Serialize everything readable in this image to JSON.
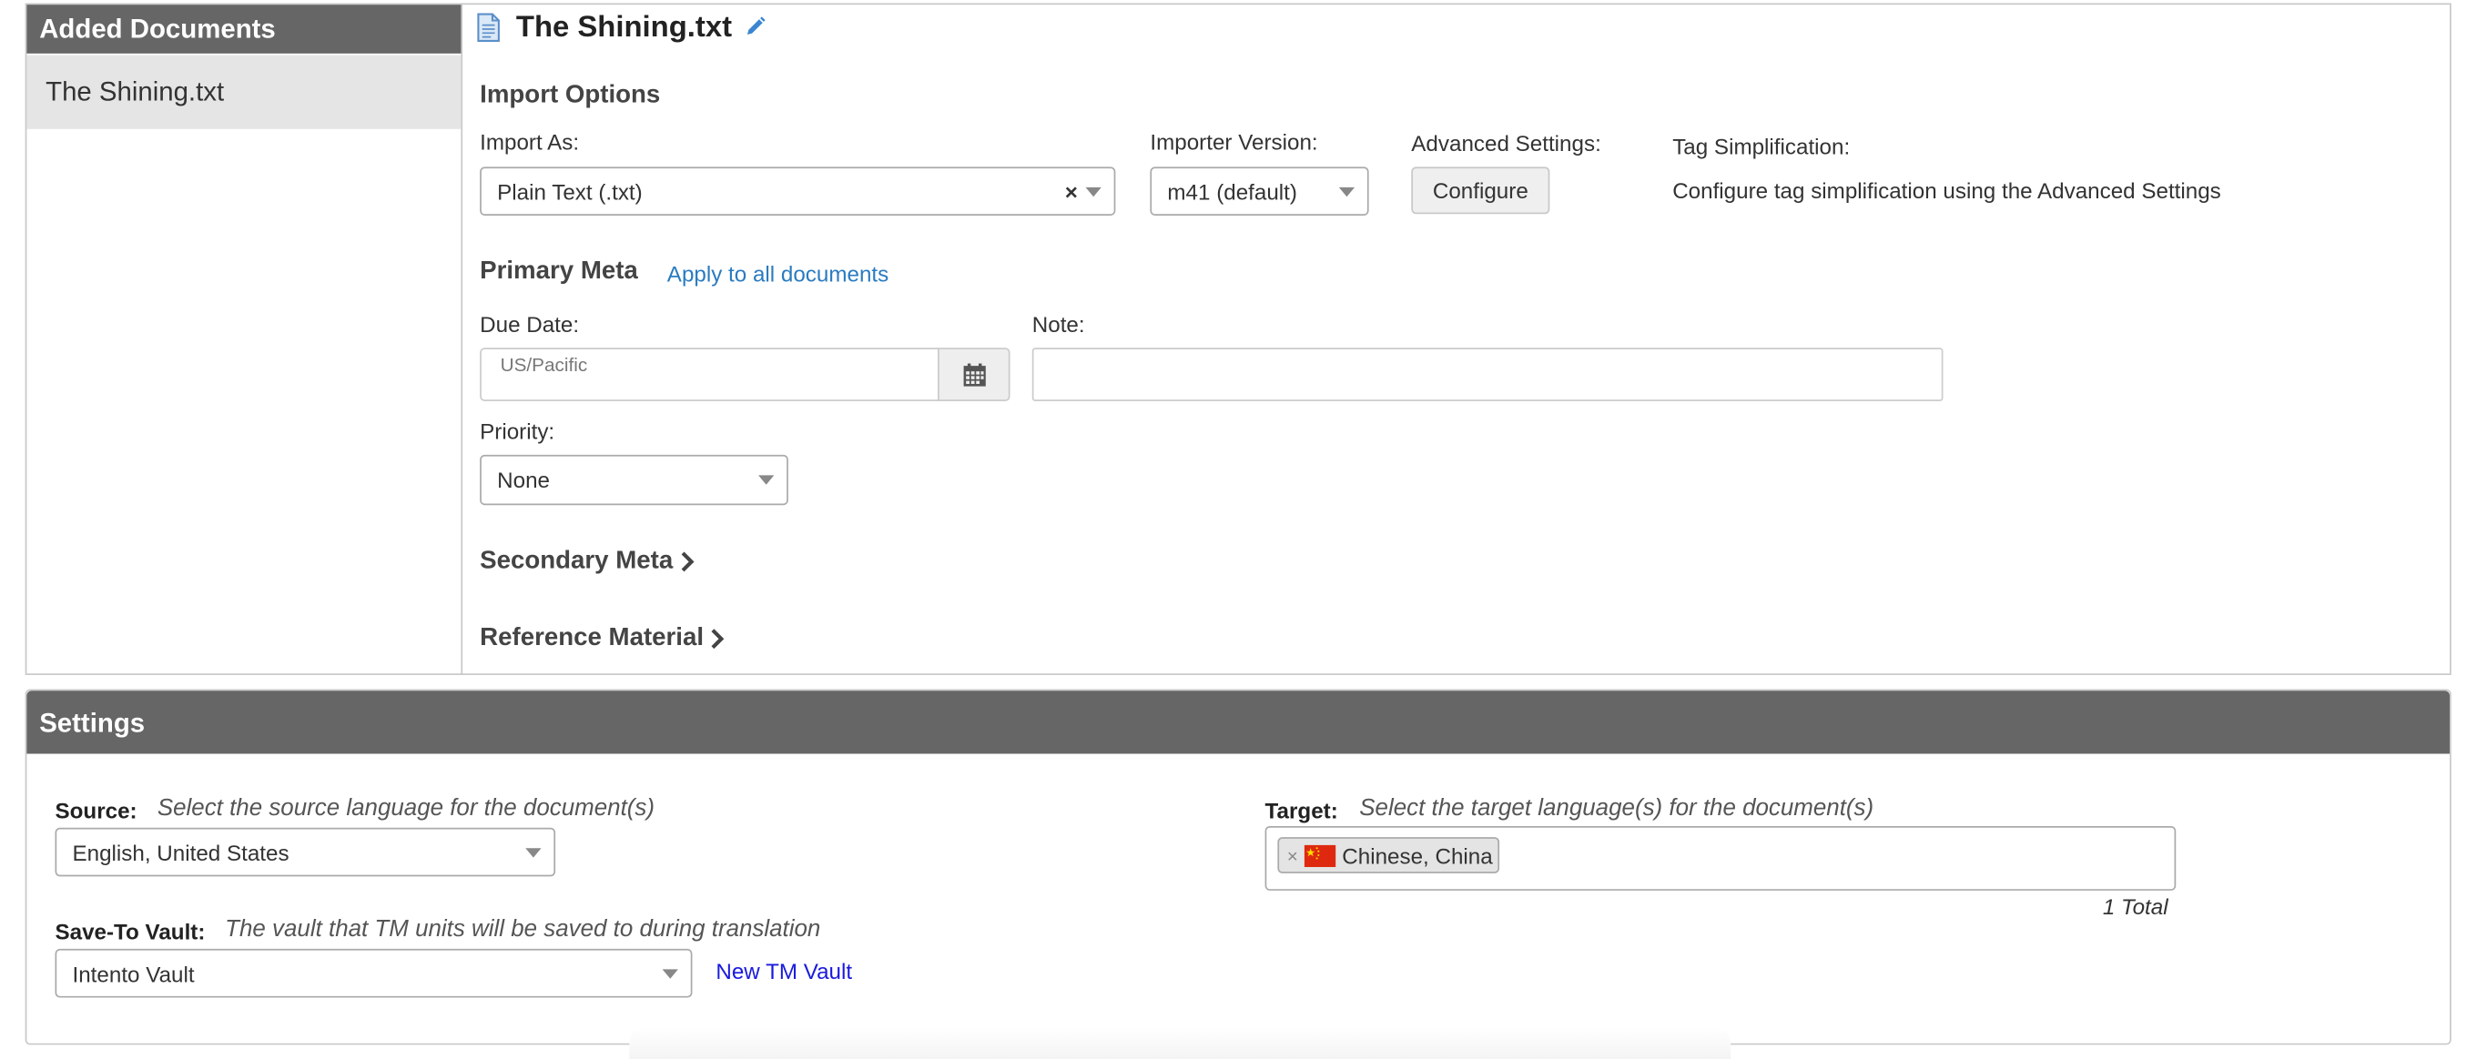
{
  "documents_panel": {
    "header": "Added Documents",
    "items": [
      {
        "label": "The Shining.txt"
      }
    ]
  },
  "document": {
    "title": "The Shining.txt",
    "icon": "file-text-icon",
    "edit_icon": "pencil-icon"
  },
  "import_options": {
    "heading": "Import Options",
    "import_as": {
      "label": "Import As:",
      "value": "Plain Text (.txt)"
    },
    "importer_version": {
      "label": "Importer Version:",
      "value": "m41 (default)"
    },
    "advanced_settings": {
      "label": "Advanced Settings:",
      "button": "Configure"
    },
    "tag_simplification": {
      "label": "Tag Simplification:",
      "text": "Configure tag simplification using the Advanced Settings"
    }
  },
  "primary_meta": {
    "heading": "Primary Meta",
    "apply_link": "Apply to all documents",
    "due_date": {
      "label": "Due Date:",
      "timezone_hint": "US/Pacific",
      "value": ""
    },
    "note": {
      "label": "Note:",
      "value": ""
    },
    "priority": {
      "label": "Priority:",
      "value": "None"
    }
  },
  "secondary_meta": {
    "label": "Secondary Meta"
  },
  "reference_material": {
    "label": "Reference Material"
  },
  "settings": {
    "header": "Settings",
    "source": {
      "label": "Source:",
      "description": "Select the source language for the document(s)",
      "value": "English, United States"
    },
    "target": {
      "label": "Target:",
      "description": "Select the target language(s) for the document(s)",
      "selected": [
        {
          "label": "Chinese, China",
          "flag": "flag-china-icon"
        }
      ],
      "total": "1 Total"
    },
    "vault": {
      "label": "Save-To Vault:",
      "description": "The vault that TM units will be saved to during translation",
      "value": "Intento Vault",
      "new_link": "New TM Vault"
    }
  },
  "colors": {
    "header_bg": "#666666",
    "link": "#2a7bc0",
    "vault_link": "#1a1add",
    "selected_item_bg": "#e5e5e5"
  }
}
